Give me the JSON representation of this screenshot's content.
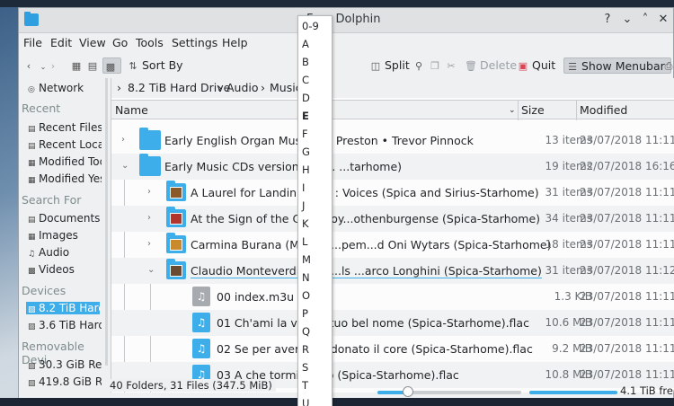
{
  "window": {
    "title": "F... – Dolphin",
    "controls": [
      "?",
      "⌄",
      "˄",
      "✕"
    ]
  },
  "menubar": [
    "File",
    "Edit",
    "View",
    "Go",
    "Tools",
    "Settings",
    "Help"
  ],
  "toolbar": {
    "sort_by": "Sort By",
    "split": "Split",
    "delete": "Delete",
    "quit": "Quit",
    "show_menubar": "Show Menubar"
  },
  "sidebar": {
    "network": "Network",
    "recent_heading": "Recent",
    "recent": [
      "Recent Files",
      "Recent Locat",
      "Modified Toc",
      "Modified Yes"
    ],
    "search_heading": "Search For",
    "search": [
      "Documents",
      "Images",
      "Audio",
      "Videos"
    ],
    "devices_heading": "Devices",
    "devices": [
      "8.2 TiB Hard",
      "3.6 TiB Hard"
    ],
    "removable_heading": "Removable Devi",
    "removable": [
      "30.3 GiB Ren",
      "419.8 GiB R"
    ]
  },
  "breadcrumb": [
    "8.2 TiB Hard Drive",
    "Audio",
    "Music"
  ],
  "columns": {
    "name": "Name",
    "size": "Size",
    "modified": "Modified"
  },
  "rows": [
    {
      "name": "Early English Organ Music - ... Preston • Trevor Pinnock",
      "size": "13 items",
      "modified": "23/07/2018 11:11"
    },
    {
      "name": "Early Music CDs version 3  (S... ...tarhome)",
      "size": "19 items",
      "modified": "22/07/2018 16:16"
    },
    {
      "name": "A Laurel for Landini by ... : Voices (Spica and Sirius-Starhome)",
      "size": "31 items",
      "modified": "23/07/2018 11:11"
    },
    {
      "name": "At the Sign of the Crur ...oy...othenburgense (Spica-Starhome)",
      "size": "34 items",
      "modified": "23/07/2018 11:11"
    },
    {
      "name": "Carmina Burana (Medi... ...pem...d Oni Wytars (Spica-Starhome)",
      "size": "18 items",
      "modified": "23/07/2018 11:11"
    },
    {
      "name": "Claudio Monteverdi: M... ...ls ...arco Longhini (Spica-Starhome)",
      "size": "31 items",
      "modified": "23/07/2018 11:12"
    },
    {
      "name": "00 index.m3u",
      "size": "1.3 KiB",
      "modified": "23/07/2018 11:11"
    },
    {
      "name": "01 Ch'ami la vita ... tuo bel nome (Spica-Starhome).flac",
      "size": "10.6 MiB",
      "modified": "23/07/2018 11:11"
    },
    {
      "name": "02 Se per avervi, ... donato il core (Spica-Starhome).flac",
      "size": "9.2 MiB",
      "modified": "23/07/2018 11:11"
    },
    {
      "name": "03 A che tormi il ... o (Spica-Starhome).flac",
      "size": "10.8 MiB",
      "modified": "23/07/2018 11:11"
    }
  ],
  "status": {
    "summary": "40 Folders, 31 Files (347.5 MiB)",
    "free": "4.1 TiB free",
    "zoom_level": 0.2
  },
  "jump_letters": [
    "0-9",
    "A",
    "B",
    "C",
    "D",
    "E",
    "F",
    "G",
    "H",
    "I",
    "J",
    "K",
    "L",
    "M",
    "N",
    "O",
    "P",
    "Q",
    "R",
    "S",
    "T",
    "U"
  ],
  "colors": {
    "accent": "#3daee9",
    "window_bg": "#eff0f1",
    "view_bg": "#fcfcfc"
  }
}
